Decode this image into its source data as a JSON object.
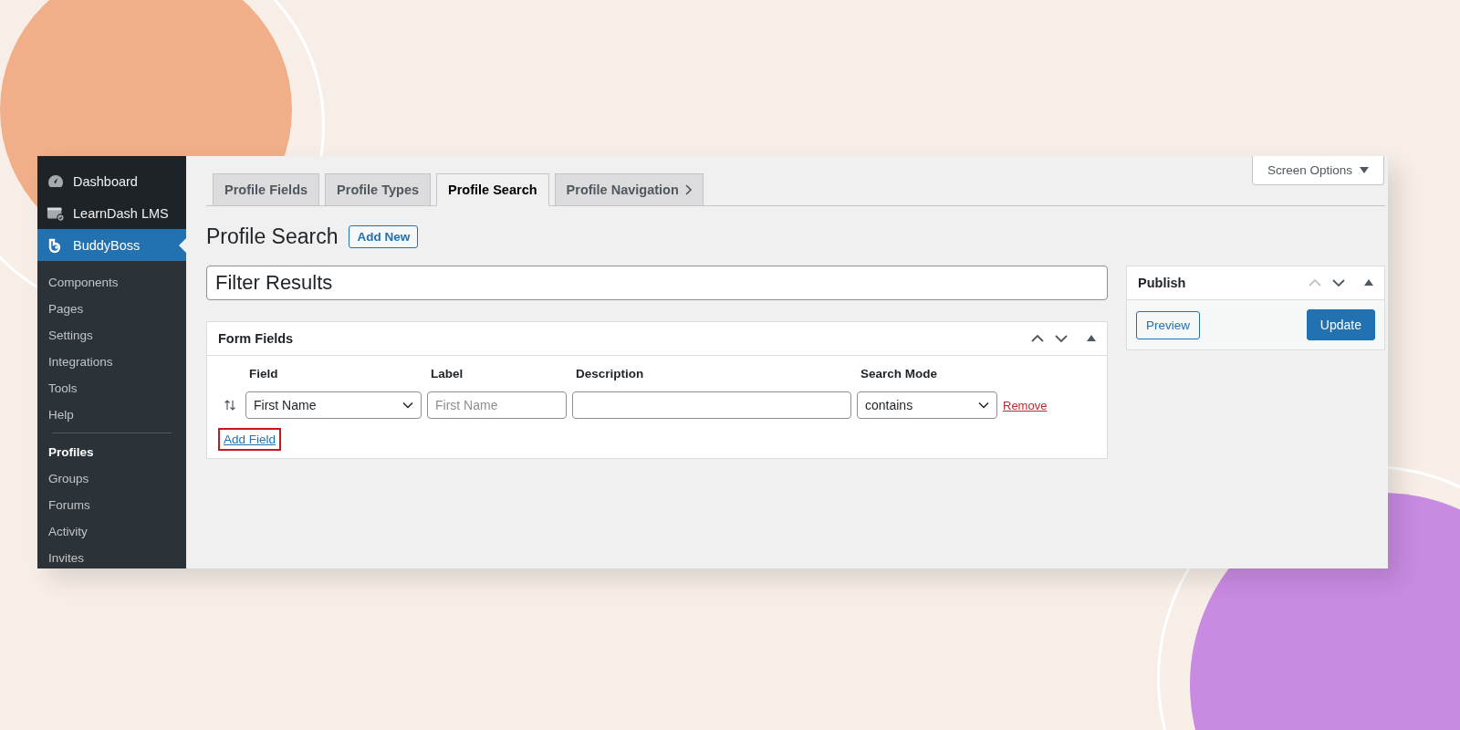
{
  "sidebar": {
    "menu": [
      {
        "label": "Dashboard",
        "selected": false
      },
      {
        "label": "LearnDash LMS",
        "selected": false
      },
      {
        "label": "BuddyBoss",
        "selected": true
      }
    ],
    "submenu_groups": [
      [
        {
          "label": "Components",
          "selected": false
        },
        {
          "label": "Pages",
          "selected": false
        },
        {
          "label": "Settings",
          "selected": false
        },
        {
          "label": "Integrations",
          "selected": false
        },
        {
          "label": "Tools",
          "selected": false
        },
        {
          "label": "Help",
          "selected": false
        }
      ],
      [
        {
          "label": "Profiles",
          "selected": true
        },
        {
          "label": "Groups",
          "selected": false
        },
        {
          "label": "Forums",
          "selected": false
        },
        {
          "label": "Activity",
          "selected": false
        },
        {
          "label": "Invites",
          "selected": false
        }
      ]
    ]
  },
  "tabs": [
    {
      "label": "Profile Fields",
      "selected": false,
      "more": false
    },
    {
      "label": "Profile Types",
      "selected": false,
      "more": false
    },
    {
      "label": "Profile Search",
      "selected": true,
      "more": false
    },
    {
      "label": "Profile Navigation",
      "selected": false,
      "more": true
    }
  ],
  "screen_options": {
    "label": "Screen Options"
  },
  "page_title": "Profile Search",
  "add_new": "Add New",
  "title_field": {
    "value": "Filter Results"
  },
  "form_fields": {
    "title": "Form Fields",
    "move_up_disabled": false,
    "columns": [
      "Field",
      "Label",
      "Description",
      "Search Mode"
    ],
    "rows": [
      {
        "field": "First Name",
        "label_placeholder": "First Name",
        "description": "",
        "search_mode": "contains",
        "remove": "Remove"
      }
    ],
    "add_field": {
      "label": "Add Field",
      "highlighted": true
    }
  },
  "publish": {
    "title": "Publish",
    "move_up_disabled": true,
    "preview": "Preview",
    "update": "Update"
  }
}
